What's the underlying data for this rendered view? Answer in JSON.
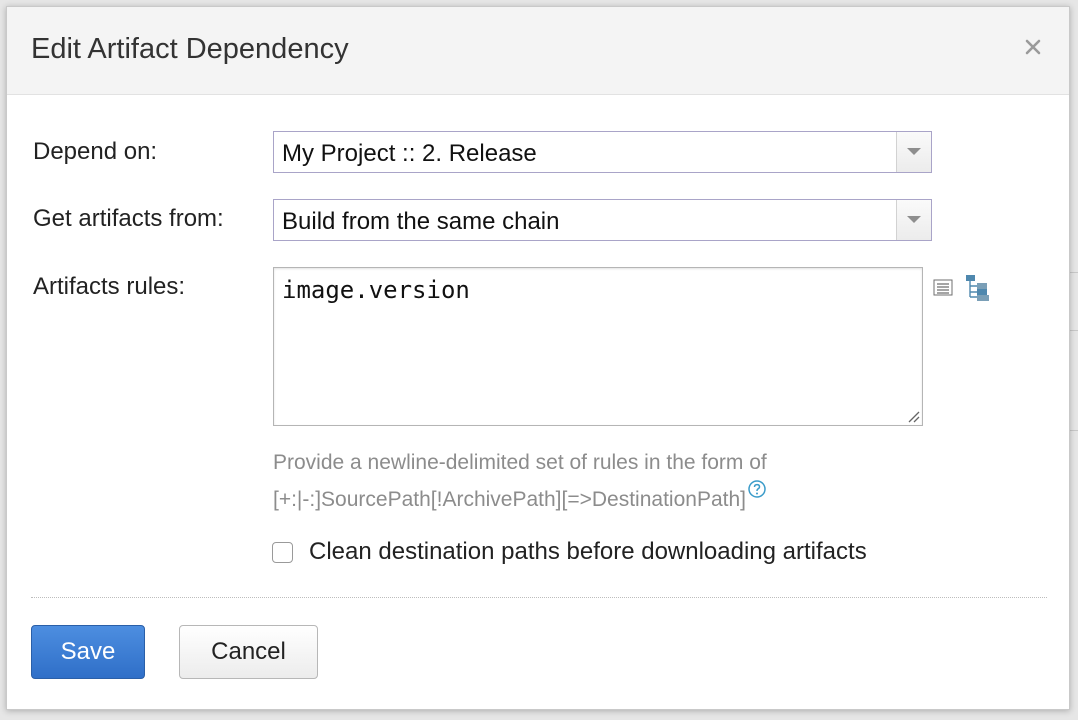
{
  "dialog": {
    "title": "Edit Artifact Dependency",
    "close_icon": "close-icon"
  },
  "form": {
    "depend_on": {
      "label": "Depend on:",
      "value": "My Project :: 2. Release"
    },
    "get_artifacts_from": {
      "label": "Get artifacts from:",
      "value": "Build from the same chain"
    },
    "artifacts_rules": {
      "label": "Artifacts rules:",
      "value": "image.version",
      "icons": [
        "list-icon",
        "tree-icon"
      ]
    },
    "hint": {
      "line1": "Provide a newline-delimited set of rules in the form of",
      "line2": "[+:|-:]SourcePath[!ArchivePath][=>DestinationPath]",
      "help_icon": "help-icon"
    },
    "clean_destination": {
      "label": "Clean destination paths before downloading artifacts",
      "checked": false
    }
  },
  "buttons": {
    "save_label": "Save",
    "cancel_label": "Cancel"
  },
  "colors": {
    "primary_button": "#3a7bd5",
    "hint_text": "#8c8c8c",
    "help_icon": "#3a9bc9"
  }
}
